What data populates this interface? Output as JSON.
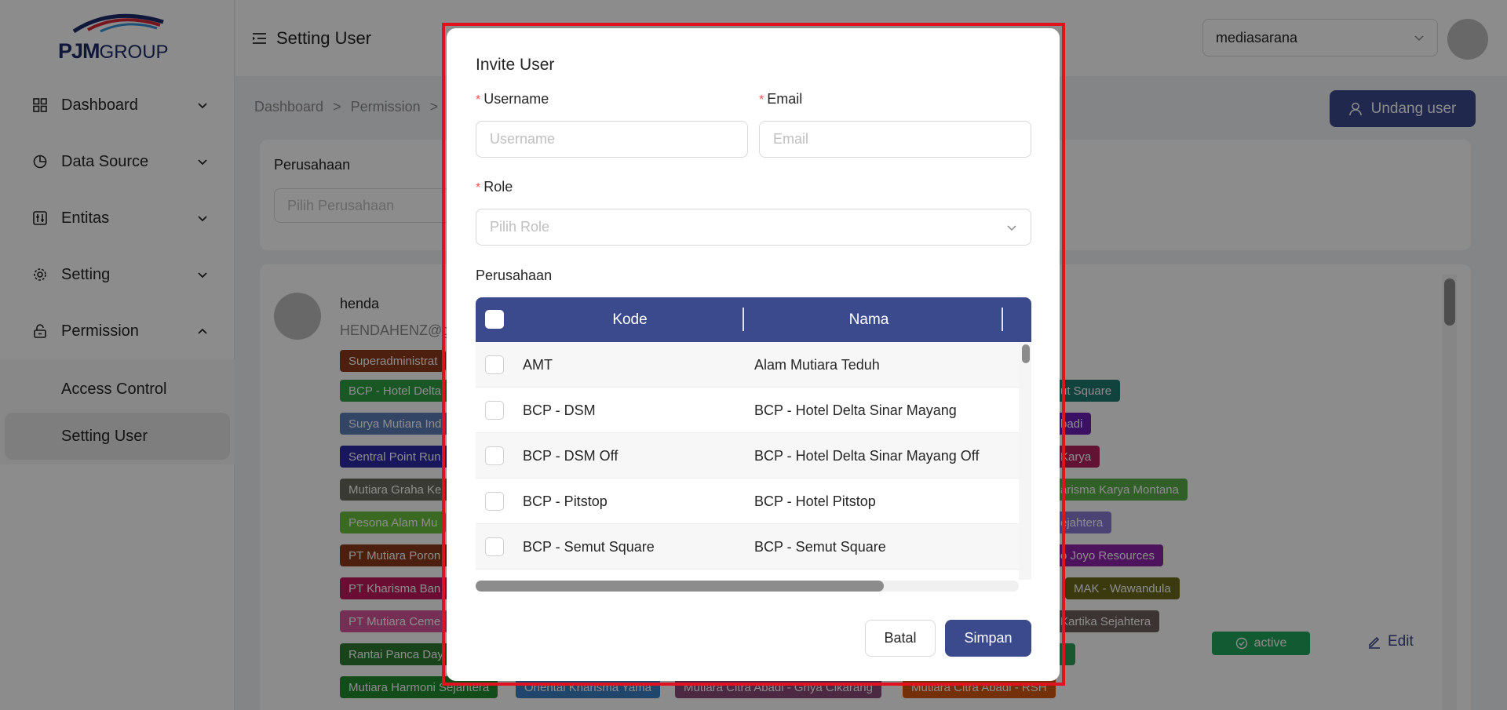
{
  "app": {
    "logo_text": "PJM",
    "logo_group": "GROUP"
  },
  "sidebar": {
    "items": [
      {
        "label": "Dashboard",
        "icon": "dashboard-icon"
      },
      {
        "label": "Data Source",
        "icon": "pie-chart-icon"
      },
      {
        "label": "Entitas",
        "icon": "sliders-icon"
      },
      {
        "label": "Setting",
        "icon": "gear-icon"
      },
      {
        "label": "Permission",
        "icon": "lock-icon"
      }
    ],
    "submenu": [
      {
        "label": "Access Control"
      },
      {
        "label": "Setting User",
        "active": true
      }
    ]
  },
  "header": {
    "title": "Setting User",
    "company_value": "mediasarana"
  },
  "content": {
    "breadcrumb": [
      "Dashboard",
      ">",
      "Permission",
      ">"
    ],
    "invite_button": "Undang user",
    "filter_label": "Perusahaan",
    "filter_placeholder": "Pilih Perusahaan",
    "user": {
      "name": "henda",
      "email": "HENDAHENZ@g",
      "status": "active",
      "edit_label": "Edit"
    },
    "tags": [
      {
        "text": "Superadministrat",
        "color": "#8b3a1a"
      },
      {
        "text": "BCP - Hotel Delta",
        "color": "#2f9e44"
      },
      {
        "text": "Surya Mutiara Ind",
        "color": "#5b7fb8"
      },
      {
        "text": "Sentral Point Run",
        "color": "#2d2aa8"
      },
      {
        "text": "Mutiara Graha Ke",
        "color": "#6b6b5f"
      },
      {
        "text": "Pesona Alam Mu",
        "color": "#6bbf3d"
      },
      {
        "text": "PT Mutiara Poron",
        "color": "#8a3a1a"
      },
      {
        "text": "PT Kharisma Ban",
        "color": "#c2185b"
      },
      {
        "text": "PT Mutiara Ceme",
        "color": "#d6549a"
      },
      {
        "text": "Rantai Panca Day",
        "color": "#2e7d32"
      },
      {
        "text": "Mutiara Harmoni Sejahtera",
        "color": "#1f8a2e"
      },
      {
        "text": "Oriental Kharisma Yama",
        "color": "#3b82c4"
      },
      {
        "text": "Mutiara Citra Abadi - Griya Cikarang",
        "color": "#8a4a7a"
      },
      {
        "text": "Mutiara Citra Abadi - RSH",
        "color": "#d45a12"
      },
      {
        "text": "ut Square",
        "color": "#1e7a70"
      },
      {
        "text": "badi",
        "color": "#6a1fb8"
      },
      {
        "text": "Karya",
        "color": "#b3245f"
      },
      {
        "text": "arisma Karya Montana",
        "color": "#58b04a"
      },
      {
        "text": "ejahtera",
        "color": "#8a7ad6"
      },
      {
        "text": "o Joyo Resources",
        "color": "#8e24aa"
      },
      {
        "text": "MAK - Wawandula",
        "color": "#6b6b1a"
      },
      {
        "text": "Kartika Sejahtera",
        "color": "#6d5d5d"
      },
      {
        "text": "",
        "color": "#2e9e5a"
      }
    ]
  },
  "modal": {
    "title": "Invite User",
    "username_label": "Username",
    "username_placeholder": "Username",
    "email_label": "Email",
    "email_placeholder": "Email",
    "role_label": "Role",
    "role_placeholder": "Pilih Role",
    "perusahaan_label": "Perusahaan",
    "table": {
      "columns": [
        "Kode",
        "Nama"
      ],
      "rows": [
        {
          "kode": "AMT",
          "nama": "Alam Mutiara Teduh"
        },
        {
          "kode": "BCP - DSM",
          "nama": "BCP - Hotel Delta Sinar Mayang"
        },
        {
          "kode": "BCP - DSM Off",
          "nama": "BCP - Hotel Delta Sinar Mayang Off"
        },
        {
          "kode": "BCP - Pitstop",
          "nama": "BCP - Hotel Pitstop"
        },
        {
          "kode": "BCP - Semut Square",
          "nama": "BCP - Semut Square"
        }
      ]
    },
    "cancel_label": "Batal",
    "save_label": "Simpan"
  }
}
